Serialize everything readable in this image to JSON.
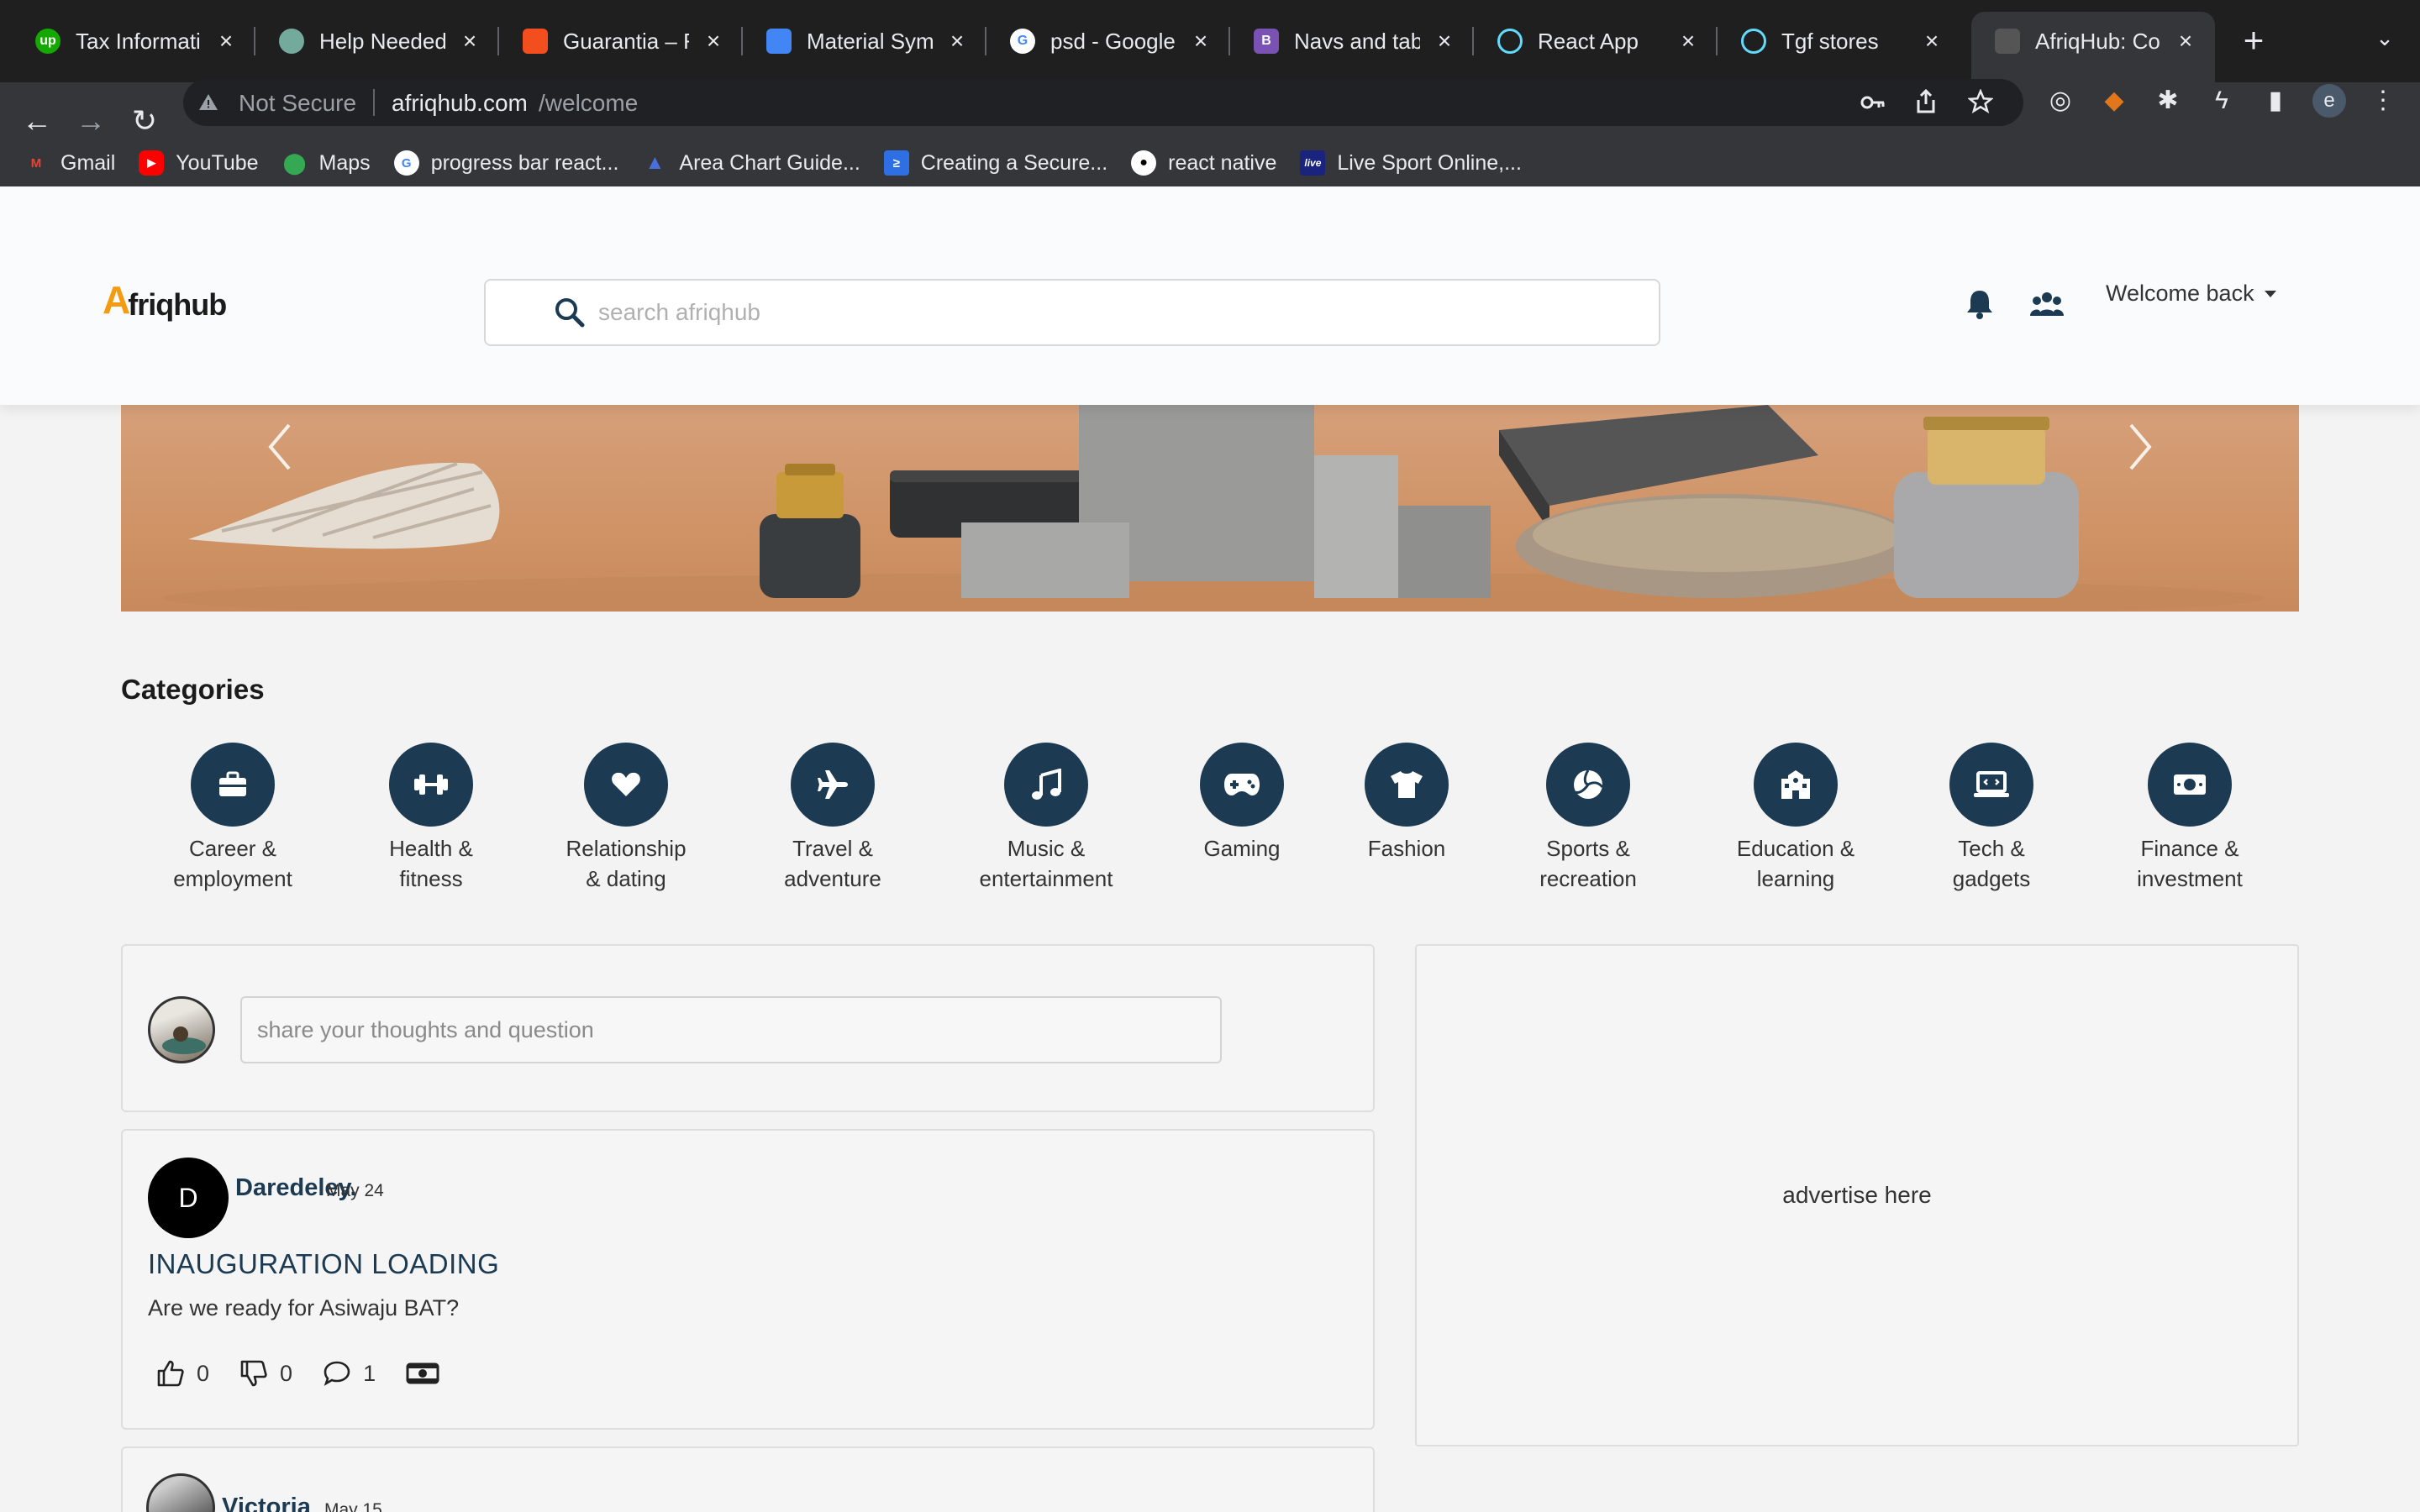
{
  "browser": {
    "tabs": [
      {
        "title": "Tax Information",
        "favicon": "upwork-icon",
        "fav_color": "#14a800",
        "fav_text": "up"
      },
      {
        "title": "Help Needed / ",
        "favicon": "chatgpt-icon",
        "fav_color": "#74aa9c",
        "fav_text": ""
      },
      {
        "title": "Guarantia – Fig",
        "favicon": "figma-icon",
        "fav_color": "#f24e1e",
        "fav_text": ""
      },
      {
        "title": "Material Symb",
        "favicon": "material-icon",
        "fav_color": "#4285f4",
        "fav_text": ""
      },
      {
        "title": "psd - Google S",
        "favicon": "google-icon",
        "fav_color": "#ffffff",
        "fav_text": "G"
      },
      {
        "title": "Navs and tabs",
        "favicon": "bootstrap-icon",
        "fav_color": "#7952b3",
        "fav_text": "B"
      },
      {
        "title": "React App",
        "favicon": "react-icon",
        "fav_color": "#61dafb",
        "fav_text": ""
      },
      {
        "title": "Tgf stores",
        "favicon": "react-icon",
        "fav_color": "#61dafb",
        "fav_text": ""
      },
      {
        "title": "AfriqHub: Con",
        "favicon": "afriqhub-icon",
        "fav_color": "#555555",
        "fav_text": ""
      }
    ],
    "active_tab": 8,
    "security_label": "Not Secure",
    "url_domain": "afriqhub.com",
    "url_path": "/welcome",
    "profile_initial": "e",
    "bookmarks": [
      {
        "label": "Gmail",
        "icon": "gmail-icon",
        "color": "#ea4335",
        "text": "M"
      },
      {
        "label": "YouTube",
        "icon": "youtube-icon",
        "color": "#ff0000",
        "text": "▶"
      },
      {
        "label": "Maps",
        "icon": "maps-icon",
        "color": "#34a853",
        "text": "●"
      },
      {
        "label": "progress bar react...",
        "icon": "google-icon",
        "color": "#ffffff",
        "text": "G"
      },
      {
        "label": "Area Chart Guide...",
        "icon": "chart-icon",
        "color": "#4a6fdc",
        "text": "▲"
      },
      {
        "label": "Creating a Secure...",
        "icon": "bookmark-site-icon",
        "color": "#2f6fe4",
        "text": "≥"
      },
      {
        "label": "react native",
        "icon": "github-icon",
        "color": "#ffffff",
        "text": "●"
      },
      {
        "label": "Live Sport Online,...",
        "icon": "live-icon",
        "color": "#1a237e",
        "text": "live"
      }
    ]
  },
  "header": {
    "logo_a": "A",
    "logo_rest": "friqhub",
    "search_placeholder": "search afriqhub",
    "welcome_label": "Welcome back"
  },
  "categories_title": "Categories",
  "categories": [
    {
      "label": "Career &\nemployment",
      "icon": "briefcase-icon"
    },
    {
      "label": "Health &\nfitness",
      "icon": "dumbbell-icon"
    },
    {
      "label": "Relationship\n& dating",
      "icon": "heart-icon"
    },
    {
      "label": "Travel &\nadventure",
      "icon": "airplane-icon"
    },
    {
      "label": "Music &\nentertainment",
      "icon": "music-note-icon"
    },
    {
      "label": "Gaming",
      "icon": "gamepad-icon"
    },
    {
      "label": "Fashion",
      "icon": "tshirt-icon"
    },
    {
      "label": "Sports &\nrecreation",
      "icon": "volleyball-icon"
    },
    {
      "label": "Education &\nlearning",
      "icon": "school-icon"
    },
    {
      "label": "Tech &\ngadgets",
      "icon": "laptop-icon"
    },
    {
      "label": "Finance &\ninvestment",
      "icon": "money-icon"
    }
  ],
  "composer": {
    "placeholder": "share your thoughts and question"
  },
  "posts": [
    {
      "avatar_initial": "D",
      "author": "Daredeley.",
      "date": "May 24",
      "title": "INAUGURATION LOADING",
      "body": "Are we ready for Asiwaju BAT?",
      "likes": "0",
      "dislikes": "0",
      "comments": "1"
    },
    {
      "author": "Victoria",
      "date": "May 15"
    }
  ],
  "ad_text": "advertise here",
  "colors": {
    "brand_dark": "#1c3a52",
    "logo_accent": "#f39c12"
  }
}
